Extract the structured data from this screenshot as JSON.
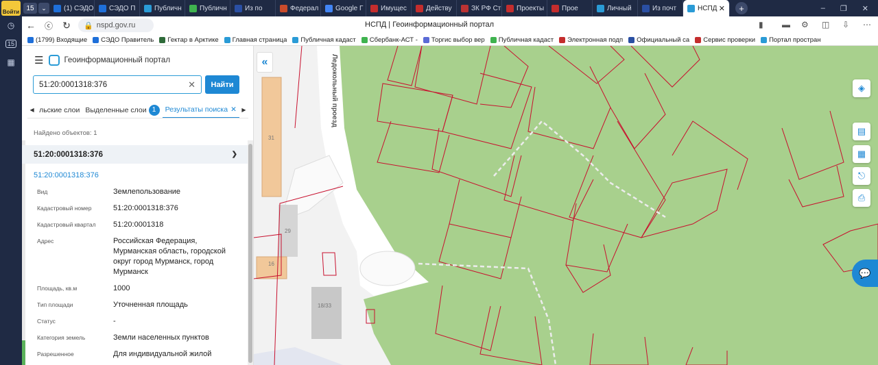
{
  "browser": {
    "login_label": "Войти",
    "tab_count": "15",
    "tabs": [
      {
        "label": "(1) СЭДО",
        "color": "#1e6fd9"
      },
      {
        "label": "СЭДО П",
        "color": "#1e6fd9"
      },
      {
        "label": "Публичн",
        "color": "#2a9bd6"
      },
      {
        "label": "Публичн",
        "color": "#3fb34f"
      },
      {
        "label": "Из по",
        "color": "#2a4fa3"
      },
      {
        "label": "Федерал",
        "color": "#c94b2b"
      },
      {
        "label": "Google Г",
        "color": "#4285f4"
      },
      {
        "label": "Имущес",
        "color": "#c42d2d"
      },
      {
        "label": "Действу",
        "color": "#c42d2d"
      },
      {
        "label": "ЗК РФ Ст",
        "color": "#b33"
      },
      {
        "label": "Проекты",
        "color": "#c42d2d"
      },
      {
        "label": "Прое",
        "color": "#c42d2d"
      },
      {
        "label": "Личный",
        "color": "#2a9bd6"
      },
      {
        "label": "Из почт",
        "color": "#2a4fa3"
      },
      {
        "label": "НСПД",
        "color": "#2a9bd6"
      }
    ],
    "url": "nspd.gov.ru",
    "page_title": "НСПД | Геоинформационный портал",
    "bookmarks": [
      {
        "label": "(1799) Входящие",
        "color": "#1e6fd9"
      },
      {
        "label": "СЭДО Правитель",
        "color": "#1e6fd9"
      },
      {
        "label": "Гектар в Арктике",
        "color": "#2f6b3a"
      },
      {
        "label": "Главная страница",
        "color": "#2a9bd6"
      },
      {
        "label": "Публичная кадаст",
        "color": "#2a9bd6"
      },
      {
        "label": "Сбербанк-АСТ -",
        "color": "#3fb34f"
      },
      {
        "label": "Торгис выбор вер",
        "color": "#5b6bd6"
      },
      {
        "label": "Публичная кадаст",
        "color": "#3fb34f"
      },
      {
        "label": "Электронная подп",
        "color": "#c42d2d"
      },
      {
        "label": "Официальный са",
        "color": "#2a4fa3"
      },
      {
        "label": "Сервис проверки",
        "color": "#c42d2d"
      },
      {
        "label": "Портал простран",
        "color": "#2a9bd6"
      }
    ]
  },
  "panel": {
    "title": "Геоинформационный портал",
    "search_value": "51:20:0001318:376",
    "search_button": "Найти",
    "tabs": [
      {
        "label": "льские слои"
      },
      {
        "label": "Выделенные слои",
        "badge": "1"
      },
      {
        "label": "Результаты поиска"
      }
    ],
    "found_label": "Найдено объектов:  1",
    "result_header": "51:20:0001318:376",
    "result_link": "51:20:0001318:376",
    "properties": [
      {
        "key": "Вид",
        "value": "Землепользование"
      },
      {
        "key": "Кадастровый номер",
        "value": "51:20:0001318:376"
      },
      {
        "key": "Кадастровый квартал",
        "value": "51:20:0001318"
      },
      {
        "key": "Адрес",
        "value": "Российская Федерация, Мурманская область, городской округ город Мурманск, город Мурманск"
      },
      {
        "key": "Площадь, кв.м",
        "value": "1000"
      },
      {
        "key": "Тип площади",
        "value": "Уточненная площадь"
      },
      {
        "key": "Статус",
        "value": "-"
      },
      {
        "key": "Категория земель",
        "value": "Земли населенных пунктов"
      },
      {
        "key": "Разрешенное",
        "value": "Для индивидуальной жилой"
      }
    ]
  },
  "map": {
    "street_label": "Ледокольный проезд",
    "building_labels": [
      "31",
      "29",
      "16",
      "18/33"
    ],
    "colors": {
      "green": "#a8d08d",
      "parcel_line": "#c8102e",
      "building": "#f1c89a"
    }
  }
}
